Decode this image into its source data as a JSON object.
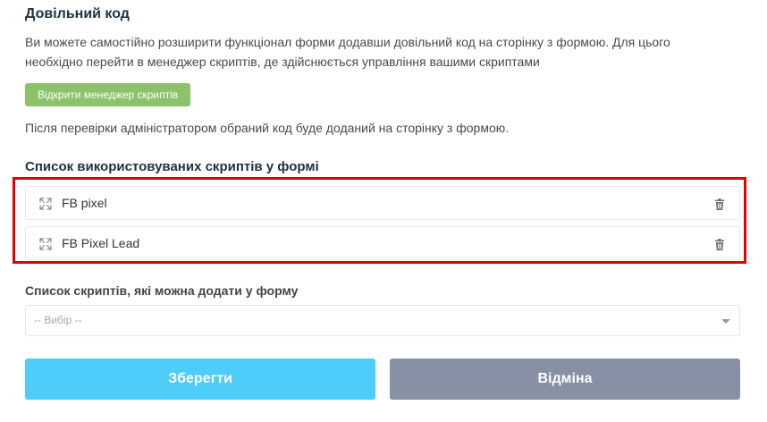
{
  "custom_code": {
    "title": "Довільний код",
    "description": "Ви можете самостійно розширити функціонал форми додавши довільний код на сторінку з формою. Для цього необхідно перейти в менеджер скриптів, де здійснюється управління вашими скриптами",
    "manager_button_label": "Відкрити менеджер скриптів",
    "note": "Після перевірки адміністратором обраний код буде доданий на сторінку з формою."
  },
  "used_scripts": {
    "title": "Список використовуваних скриптів у формі",
    "items": [
      {
        "name": "FB pixel",
        "drag_icon": "expand-arrows-icon",
        "delete_icon": "trash-icon"
      },
      {
        "name": "FB Pixel Lead",
        "drag_icon": "expand-arrows-icon",
        "delete_icon": "trash-icon"
      }
    ],
    "highlight_color": "#e50000"
  },
  "available_scripts": {
    "label": "Список скриптів, які можна додати у форму",
    "selected_value": "-- Вибір --"
  },
  "actions": {
    "save_label": "Зберегти",
    "cancel_label": "Відміна"
  },
  "colors": {
    "manager_button": "#8bc26a",
    "save_button": "#4ecdfa",
    "cancel_button": "#8790a4",
    "heading": "#20333f"
  }
}
